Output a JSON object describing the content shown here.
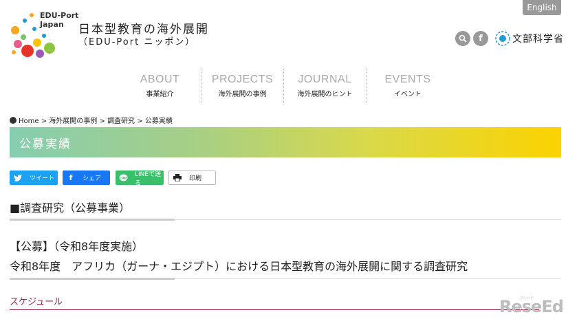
{
  "header": {
    "logo_en_line1": "EDU-Port",
    "logo_en_line2": "Japan",
    "logo_title": "日本型教育の海外展開",
    "logo_sub": "（EDU-Port ニッポン）",
    "english_label": "English",
    "mext_text": "文部科学省"
  },
  "nav": [
    {
      "en": "ABOUT",
      "jp": "事業紹介"
    },
    {
      "en": "PROJECTS",
      "jp": "海外展開の事例"
    },
    {
      "en": "JOURNAL",
      "jp": "海外展開のヒント"
    },
    {
      "en": "EVENTS",
      "jp": "イベント"
    }
  ],
  "breadcrumb": {
    "home": "Home",
    "sep": ">",
    "items": [
      "海外展開の事例",
      "調査研究",
      "公募実績"
    ]
  },
  "banner": {
    "title": "公募実績"
  },
  "share": {
    "tweet": "ツイート",
    "facebook": "シェア",
    "line": "LINEで送る",
    "print": "印刷"
  },
  "content": {
    "section_heading": "■調査研究（公募事業）",
    "post_line1": "【公募】（令和8年度実施）",
    "post_line2": "令和8年度　アフリカ（ガーナ・エジプト）における日本型教育の海外展開に関する調査研究",
    "schedule": "スケジュール"
  },
  "watermark": {
    "text": "ReseEd",
    "small": "リシード"
  },
  "colors": {
    "banner_start": "#86cdb0",
    "banner_end": "#fbd300",
    "schedule": "#9b2548",
    "twitter": "#1da1f2",
    "facebook": "#1877f2",
    "line": "#3ac06a"
  }
}
